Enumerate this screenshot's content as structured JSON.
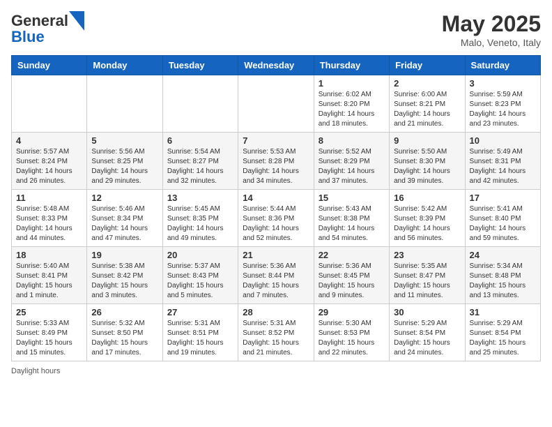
{
  "header": {
    "logo_line1": "General",
    "logo_line2": "Blue",
    "month_title": "May 2025",
    "location": "Malo, Veneto, Italy"
  },
  "days_of_week": [
    "Sunday",
    "Monday",
    "Tuesday",
    "Wednesday",
    "Thursday",
    "Friday",
    "Saturday"
  ],
  "weeks": [
    [
      {
        "day": "",
        "info": ""
      },
      {
        "day": "",
        "info": ""
      },
      {
        "day": "",
        "info": ""
      },
      {
        "day": "",
        "info": ""
      },
      {
        "day": "1",
        "info": "Sunrise: 6:02 AM\nSunset: 8:20 PM\nDaylight: 14 hours\nand 18 minutes."
      },
      {
        "day": "2",
        "info": "Sunrise: 6:00 AM\nSunset: 8:21 PM\nDaylight: 14 hours\nand 21 minutes."
      },
      {
        "day": "3",
        "info": "Sunrise: 5:59 AM\nSunset: 8:23 PM\nDaylight: 14 hours\nand 23 minutes."
      }
    ],
    [
      {
        "day": "4",
        "info": "Sunrise: 5:57 AM\nSunset: 8:24 PM\nDaylight: 14 hours\nand 26 minutes."
      },
      {
        "day": "5",
        "info": "Sunrise: 5:56 AM\nSunset: 8:25 PM\nDaylight: 14 hours\nand 29 minutes."
      },
      {
        "day": "6",
        "info": "Sunrise: 5:54 AM\nSunset: 8:27 PM\nDaylight: 14 hours\nand 32 minutes."
      },
      {
        "day": "7",
        "info": "Sunrise: 5:53 AM\nSunset: 8:28 PM\nDaylight: 14 hours\nand 34 minutes."
      },
      {
        "day": "8",
        "info": "Sunrise: 5:52 AM\nSunset: 8:29 PM\nDaylight: 14 hours\nand 37 minutes."
      },
      {
        "day": "9",
        "info": "Sunrise: 5:50 AM\nSunset: 8:30 PM\nDaylight: 14 hours\nand 39 minutes."
      },
      {
        "day": "10",
        "info": "Sunrise: 5:49 AM\nSunset: 8:31 PM\nDaylight: 14 hours\nand 42 minutes."
      }
    ],
    [
      {
        "day": "11",
        "info": "Sunrise: 5:48 AM\nSunset: 8:33 PM\nDaylight: 14 hours\nand 44 minutes."
      },
      {
        "day": "12",
        "info": "Sunrise: 5:46 AM\nSunset: 8:34 PM\nDaylight: 14 hours\nand 47 minutes."
      },
      {
        "day": "13",
        "info": "Sunrise: 5:45 AM\nSunset: 8:35 PM\nDaylight: 14 hours\nand 49 minutes."
      },
      {
        "day": "14",
        "info": "Sunrise: 5:44 AM\nSunset: 8:36 PM\nDaylight: 14 hours\nand 52 minutes."
      },
      {
        "day": "15",
        "info": "Sunrise: 5:43 AM\nSunset: 8:38 PM\nDaylight: 14 hours\nand 54 minutes."
      },
      {
        "day": "16",
        "info": "Sunrise: 5:42 AM\nSunset: 8:39 PM\nDaylight: 14 hours\nand 56 minutes."
      },
      {
        "day": "17",
        "info": "Sunrise: 5:41 AM\nSunset: 8:40 PM\nDaylight: 14 hours\nand 59 minutes."
      }
    ],
    [
      {
        "day": "18",
        "info": "Sunrise: 5:40 AM\nSunset: 8:41 PM\nDaylight: 15 hours\nand 1 minute."
      },
      {
        "day": "19",
        "info": "Sunrise: 5:38 AM\nSunset: 8:42 PM\nDaylight: 15 hours\nand 3 minutes."
      },
      {
        "day": "20",
        "info": "Sunrise: 5:37 AM\nSunset: 8:43 PM\nDaylight: 15 hours\nand 5 minutes."
      },
      {
        "day": "21",
        "info": "Sunrise: 5:36 AM\nSunset: 8:44 PM\nDaylight: 15 hours\nand 7 minutes."
      },
      {
        "day": "22",
        "info": "Sunrise: 5:36 AM\nSunset: 8:45 PM\nDaylight: 15 hours\nand 9 minutes."
      },
      {
        "day": "23",
        "info": "Sunrise: 5:35 AM\nSunset: 8:47 PM\nDaylight: 15 hours\nand 11 minutes."
      },
      {
        "day": "24",
        "info": "Sunrise: 5:34 AM\nSunset: 8:48 PM\nDaylight: 15 hours\nand 13 minutes."
      }
    ],
    [
      {
        "day": "25",
        "info": "Sunrise: 5:33 AM\nSunset: 8:49 PM\nDaylight: 15 hours\nand 15 minutes."
      },
      {
        "day": "26",
        "info": "Sunrise: 5:32 AM\nSunset: 8:50 PM\nDaylight: 15 hours\nand 17 minutes."
      },
      {
        "day": "27",
        "info": "Sunrise: 5:31 AM\nSunset: 8:51 PM\nDaylight: 15 hours\nand 19 minutes."
      },
      {
        "day": "28",
        "info": "Sunrise: 5:31 AM\nSunset: 8:52 PM\nDaylight: 15 hours\nand 21 minutes."
      },
      {
        "day": "29",
        "info": "Sunrise: 5:30 AM\nSunset: 8:53 PM\nDaylight: 15 hours\nand 22 minutes."
      },
      {
        "day": "30",
        "info": "Sunrise: 5:29 AM\nSunset: 8:54 PM\nDaylight: 15 hours\nand 24 minutes."
      },
      {
        "day": "31",
        "info": "Sunrise: 5:29 AM\nSunset: 8:54 PM\nDaylight: 15 hours\nand 25 minutes."
      }
    ]
  ],
  "footer": {
    "note": "Daylight hours"
  }
}
